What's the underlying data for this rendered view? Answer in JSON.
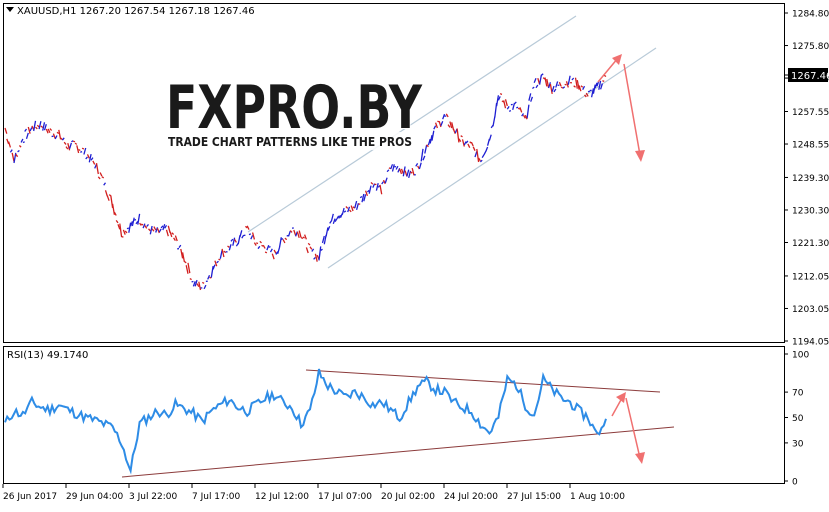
{
  "price_panel": {
    "symbol_label": "XAUUSD,H1  1267.20 1267.54 1267.18 1267.46",
    "current_price": "1267.46"
  },
  "watermark": {
    "brand": "FXPRO.BY",
    "tagline": "TRADE CHART PATTERNS LIKE THE PROS"
  },
  "rsi_panel": {
    "label": "RSI(13) 49.1740"
  },
  "colors": {
    "bull": "#1e1ed2",
    "bear": "#d21e1e",
    "rsi_line": "#2e8ce6",
    "channel": "#b4c8d8",
    "rsi_trend": "#8b3a3a",
    "arrow": "#f07070",
    "frame": "#000000"
  },
  "chart_data": [
    {
      "type": "line",
      "name": "XAUUSD H1",
      "y_ticks": [
        1194.05,
        1203.05,
        1212.05,
        1221.3,
        1230.3,
        1239.3,
        1248.55,
        1257.55,
        1266.8,
        1275.8,
        1284.8
      ],
      "ylim": [
        1194.05,
        1284.8
      ],
      "x_labels": [
        "26 Jun 2017",
        "29 Jun 04:00",
        "3 Jul 22:00",
        "7 Jul 17:00",
        "12 Jul 12:00",
        "17 Jul 07:00",
        "20 Jul 02:00",
        "24 Jul 20:00",
        "27 Jul 15:00",
        "1 Aug 10:00"
      ],
      "series": [
        {
          "values": [
            1253,
            1244,
            1250,
            1253,
            1254,
            1252,
            1251,
            1248,
            1248,
            1246,
            1243,
            1238,
            1232,
            1224,
            1226,
            1228,
            1225,
            1224,
            1225,
            1222,
            1217,
            1210,
            1209,
            1213,
            1218,
            1220,
            1222,
            1225,
            1221,
            1220,
            1218,
            1222,
            1225,
            1224,
            1219,
            1217,
            1226,
            1229,
            1230,
            1231,
            1234,
            1238,
            1236,
            1242,
            1242,
            1240,
            1242,
            1248,
            1253,
            1256,
            1253,
            1249,
            1248,
            1244,
            1250,
            1262,
            1259,
            1259,
            1255,
            1265,
            1267,
            1264,
            1265,
            1266,
            1265,
            1262,
            1264,
            1267
          ]
        }
      ]
    },
    {
      "type": "line",
      "name": "RSI(13)",
      "y_ticks": [
        0,
        30,
        50,
        70,
        100
      ],
      "ylim": [
        0,
        100
      ],
      "series": [
        {
          "values": [
            45,
            55,
            52,
            62,
            58,
            56,
            60,
            56,
            53,
            50,
            48,
            45,
            42,
            30,
            8,
            45,
            50,
            55,
            52,
            60,
            57,
            53,
            47,
            55,
            60,
            64,
            58,
            55,
            60,
            65,
            68,
            62,
            58,
            45,
            55,
            85,
            75,
            70,
            66,
            70,
            66,
            60,
            62,
            56,
            50,
            62,
            74,
            78,
            72,
            70,
            62,
            58,
            55,
            45,
            38,
            50,
            80,
            76,
            60,
            52,
            80,
            72,
            65,
            62,
            55,
            50,
            36,
            49
          ]
        }
      ]
    }
  ]
}
